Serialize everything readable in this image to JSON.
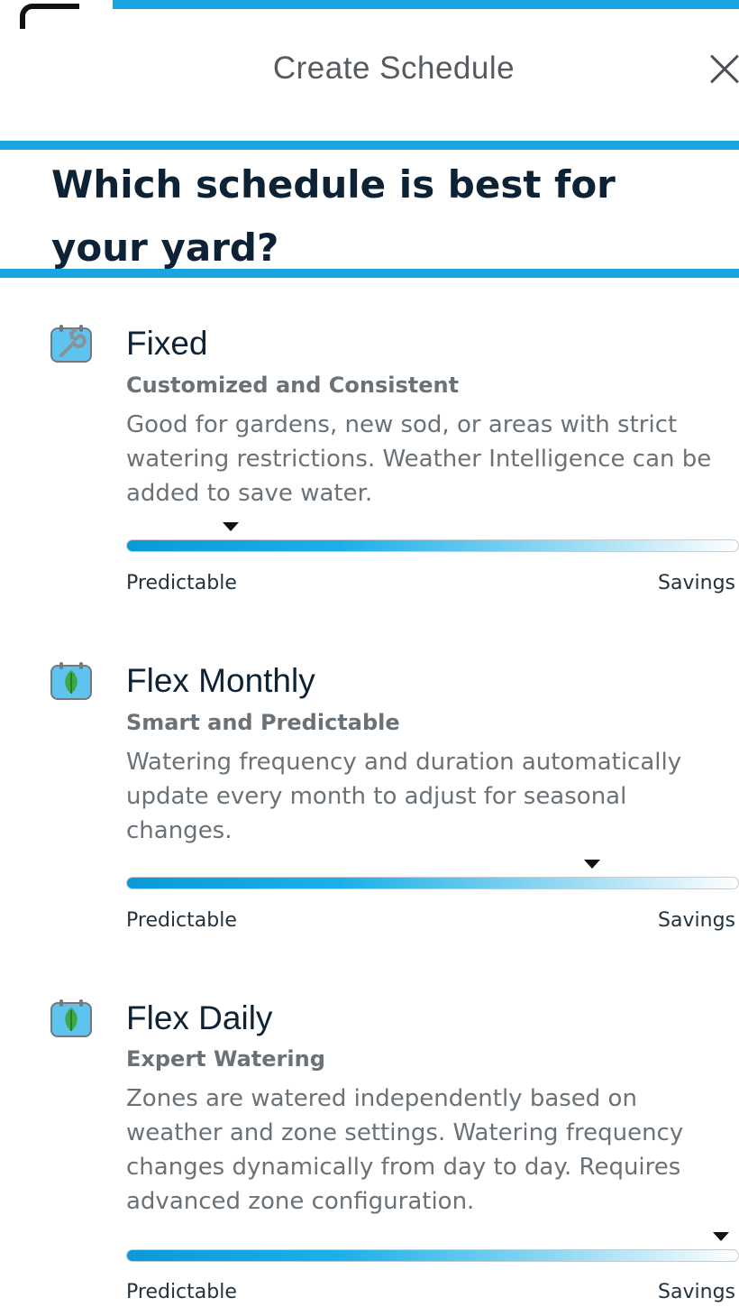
{
  "header": {
    "title": "Create Schedule"
  },
  "headline": {
    "line1": "Which schedule is best for",
    "line2": "your  yard?"
  },
  "options": [
    {
      "title": "Fixed",
      "subtitle": "Customized and Consistent",
      "description_lines": [
        "Good for gardens, new sod, or areas with strict",
        "watering restrictions. Weather Intelligence can be",
        "added to save water."
      ],
      "icon": "wrench-calendar-icon",
      "scale_position": 0.17,
      "left_label": "Predictable",
      "right_label": "Savings"
    },
    {
      "title": "Flex Monthly",
      "subtitle": "Smart and Predictable",
      "description_lines": [
        "Watering frequency and duration automatically",
        "update every month to adjust for seasonal",
        "changes."
      ],
      "icon": "leaf-calendar-icon",
      "scale_position": 0.76,
      "left_label": "Predictable",
      "right_label": "Savings"
    },
    {
      "title": "Flex Daily",
      "subtitle": "Expert Watering",
      "description_lines": [
        "Zones are watered independently based on",
        "weather and zone settings. Watering frequency",
        "changes dynamically from day to day. Requires",
        "advanced zone configuration."
      ],
      "icon": "leaf-calendar-icon",
      "scale_position": 0.97,
      "left_label": "Predictable",
      "right_label": "Savings"
    }
  ],
  "colors": {
    "accent": "#1aa5e0",
    "title": "#0d2234",
    "muted": "#6b7277"
  }
}
